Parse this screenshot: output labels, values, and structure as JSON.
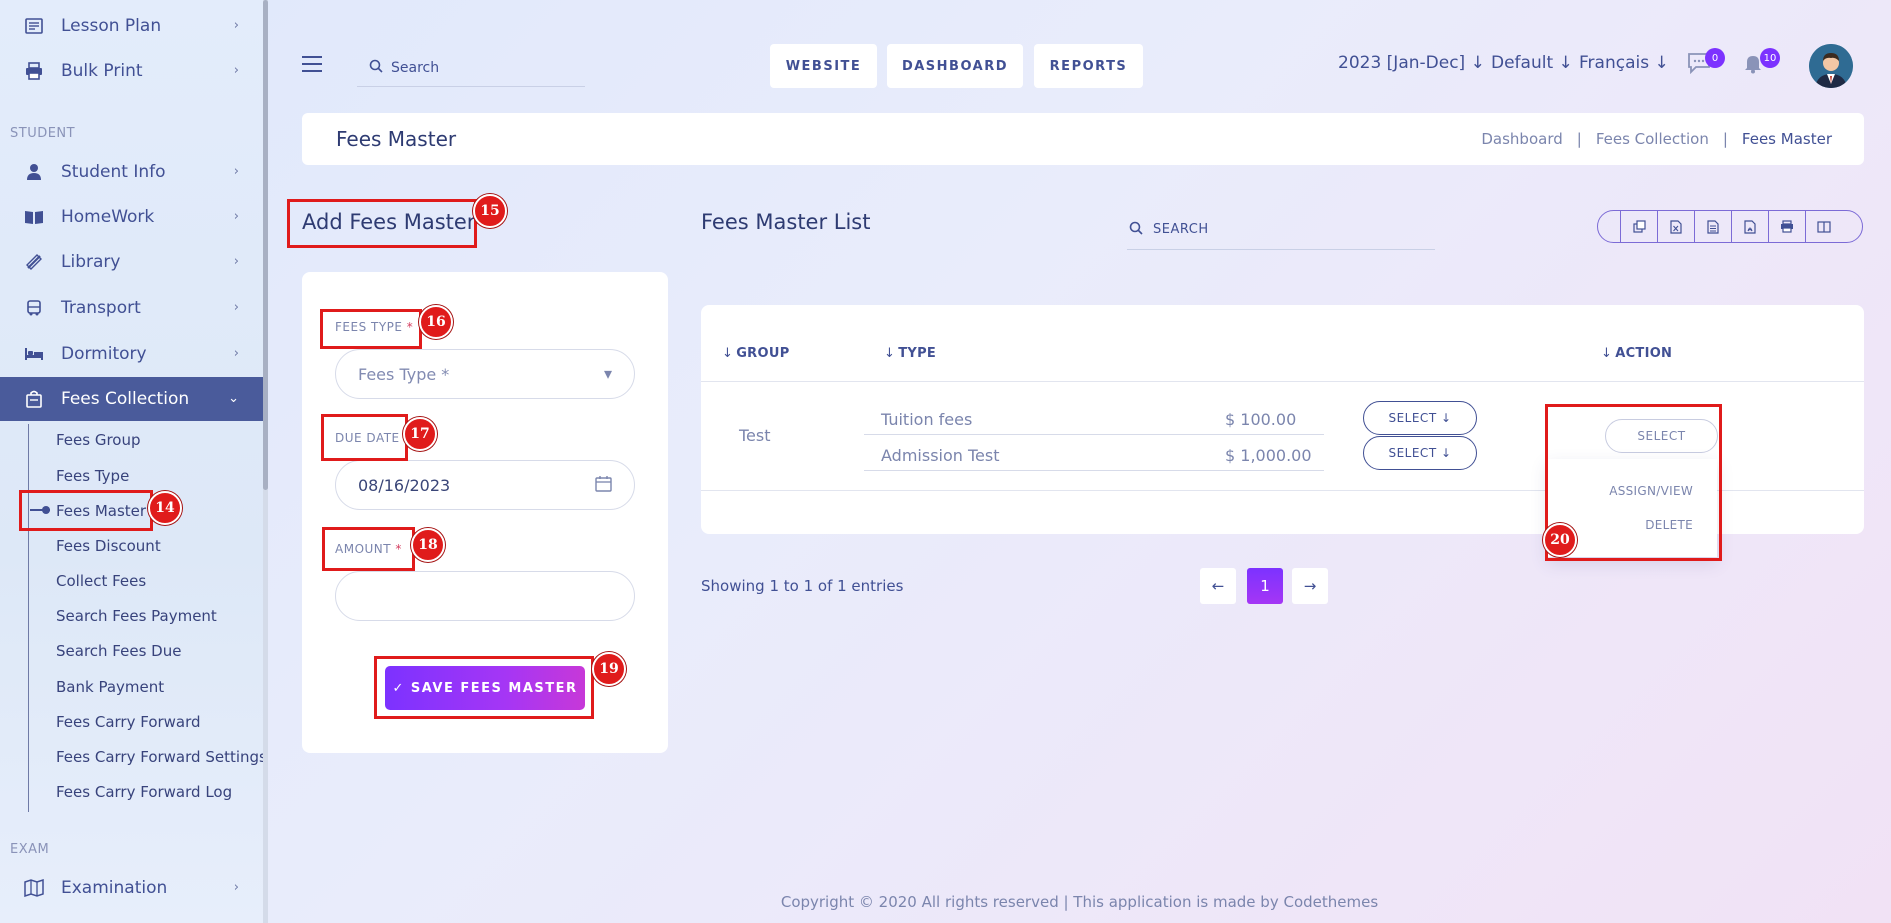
{
  "sidebar": {
    "top_items": [
      {
        "label": "Lesson Plan",
        "icon": "lesson-plan-icon"
      },
      {
        "label": "Bulk Print",
        "icon": "printer-icon"
      }
    ],
    "section_student": "STUDENT",
    "student_items": [
      {
        "label": "Student Info",
        "icon": "student-icon"
      },
      {
        "label": "HomeWork",
        "icon": "book-open-icon"
      },
      {
        "label": "Library",
        "icon": "library-icon"
      },
      {
        "label": "Transport",
        "icon": "bus-icon"
      },
      {
        "label": "Dormitory",
        "icon": "bed-icon"
      },
      {
        "label": "Fees Collection",
        "icon": "fees-icon"
      }
    ],
    "fees_sub_items": [
      "Fees Group",
      "Fees Type",
      "Fees Master",
      "Fees Discount",
      "Collect Fees",
      "Search Fees Payment",
      "Search Fees Due",
      "Bank Payment",
      "Fees Carry Forward",
      "Fees Carry Forward Settings",
      "Fees Carry Forward Log"
    ],
    "section_exam": "EXAM",
    "exam_items": [
      {
        "label": "Examination",
        "icon": "map-icon"
      }
    ]
  },
  "header": {
    "search_placeholder": "Search",
    "buttons": [
      "WEBSITE",
      "DASHBOARD",
      "REPORTS"
    ],
    "session": "2023 [Jan-Dec]",
    "school": "Default",
    "language": "Français",
    "messages_count": "0",
    "notifications_count": "10"
  },
  "breadcrumb": {
    "title": "Fees Master",
    "items": [
      "Dashboard",
      "Fees Collection",
      "Fees Master"
    ]
  },
  "form": {
    "title": "Add Fees Master",
    "fees_type_label": "FEES TYPE",
    "fees_type_placeholder": "Fees Type *",
    "due_date_label": "DUE DATE",
    "due_date_value": "08/16/2023",
    "amount_label": "AMOUNT",
    "required_mark": " *",
    "amount_value": "",
    "save_label": "SAVE FEES MASTER"
  },
  "list": {
    "title": "Fees Master List",
    "search_placeholder": "SEARCH",
    "columns": [
      "GROUP",
      "TYPE",
      "ACTION"
    ],
    "rows": [
      {
        "group": "Test",
        "types": [
          {
            "name": "Tuition fees",
            "amount": "$ 100.00",
            "select": "SELECT"
          },
          {
            "name": "Admission Test",
            "amount": "$ 1,000.00",
            "select": "SELECT"
          }
        ],
        "action": "SELECT"
      }
    ],
    "action_menu": [
      "ASSIGN/VIEW",
      "DELETE"
    ],
    "showing": "Showing 1 to 1 of 1 entries",
    "page": "1"
  },
  "footer": "Copyright © 2020 All rights reserved | This application is made by Codethemes",
  "annotations": [
    "14",
    "15",
    "16",
    "17",
    "18",
    "19",
    "20"
  ],
  "colors": {
    "accent": "#7c32ff",
    "primary_text": "#415094",
    "active_nav": "#4a5b9b",
    "annotation": "#e01b1b"
  }
}
